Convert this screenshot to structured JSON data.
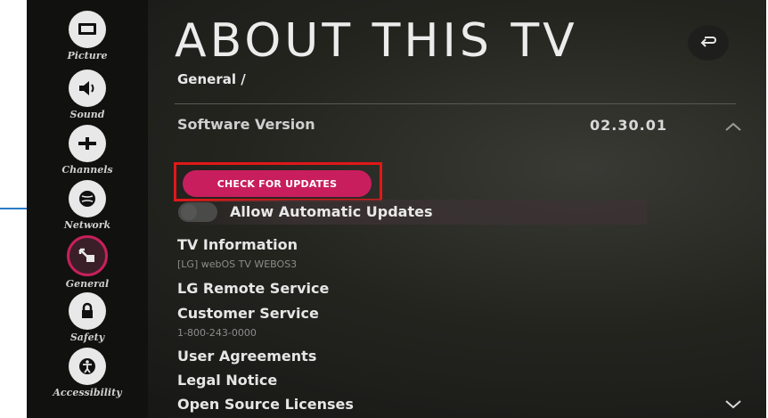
{
  "sidebar": {
    "items": [
      {
        "label": "Picture",
        "icon": "picture-icon"
      },
      {
        "label": "Sound",
        "icon": "speaker-icon"
      },
      {
        "label": "Channels",
        "icon": "antenna-icon"
      },
      {
        "label": "Network",
        "icon": "globe-icon"
      },
      {
        "label": "General",
        "icon": "general-settings-icon",
        "active": true
      },
      {
        "label": "Safety",
        "icon": "lock-icon"
      },
      {
        "label": "Accessibility",
        "icon": "accessibility-icon"
      }
    ]
  },
  "header": {
    "title": "ABOUT THIS TV",
    "breadcrumb": "General /",
    "back_icon": "back-arrow-icon"
  },
  "software": {
    "label": "Software Version",
    "value": "02.30.01"
  },
  "updates": {
    "check_button": "CHECK FOR UPDATES",
    "auto_label": "Allow Automatic Updates",
    "auto_enabled": false
  },
  "menu": {
    "tv_info": {
      "label": "TV Information",
      "sub": "[LG] webOS TV WEBOS3"
    },
    "remote_service": {
      "label": "LG Remote Service"
    },
    "customer_service": {
      "label": "Customer Service",
      "sub": "1-800-243-0000"
    },
    "user_agreements": {
      "label": "User Agreements"
    },
    "legal_notice": {
      "label": "Legal Notice"
    },
    "open_source": {
      "label": "Open Source Licenses"
    }
  },
  "colors": {
    "accent": "#c81e5e",
    "highlight_box": "#e01818",
    "callout_line": "#2a7cc7"
  }
}
